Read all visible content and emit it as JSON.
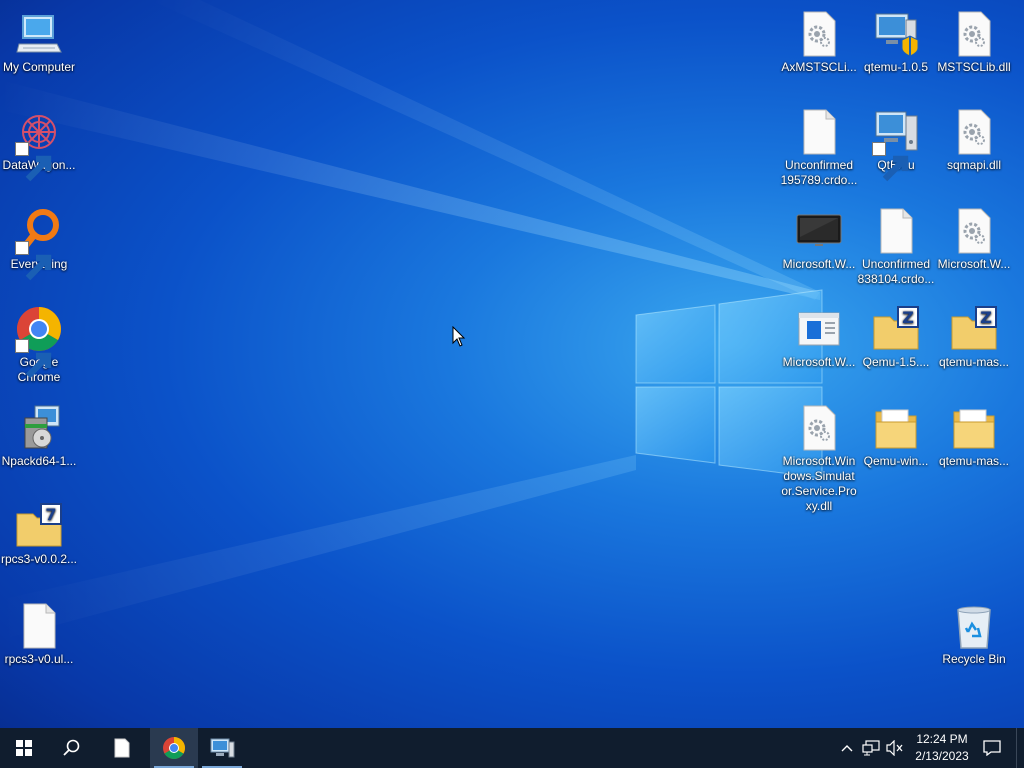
{
  "desktop": {
    "left_icons": [
      {
        "label": "My Computer",
        "icon": "computer-icon"
      },
      {
        "label": "DataWagon...",
        "icon": "datawagon-icon"
      },
      {
        "label": "Everything",
        "icon": "everything-icon"
      },
      {
        "label": "Google Chrome",
        "icon": "chrome-icon"
      },
      {
        "label": "Npackd64-1...",
        "icon": "installer-icon"
      },
      {
        "label": "rpcs3-v0.0.2...",
        "icon": "archive-7z-icon"
      },
      {
        "label": "rpcs3-v0.ul...",
        "icon": "blank-file-icon"
      }
    ],
    "right_icons": [
      {
        "label": "AxMSTSCLi...",
        "icon": "dll-file-icon"
      },
      {
        "label": "qtemu-1.0.5",
        "icon": "qtemu-setup-icon"
      },
      {
        "label": "MSTSCLib.dll",
        "icon": "dll-file-icon"
      },
      {
        "label": "Unconfirmed 195789.crdo...",
        "icon": "blank-file-icon"
      },
      {
        "label": "QtEmu",
        "icon": "qtemu-icon"
      },
      {
        "label": "sqmapi.dll",
        "icon": "dll-file-icon"
      },
      {
        "label": "Microsoft.W...",
        "icon": "monitor-icon"
      },
      {
        "label": "Unconfirmed 838104.crdo...",
        "icon": "blank-file-icon"
      },
      {
        "label": "Microsoft.W...",
        "icon": "dll-file-icon"
      },
      {
        "label": "Microsoft.W...",
        "icon": "window-app-icon"
      },
      {
        "label": "Qemu-1.5....",
        "icon": "archive-zip-folder-icon"
      },
      {
        "label": "qtemu-mas...",
        "icon": "archive-zip-folder-icon"
      },
      {
        "label": "Microsoft.Windows.Simulator.Service.Proxy.dll",
        "icon": "dll-file-icon"
      },
      {
        "label": "Qemu-win...",
        "icon": "folder-icon"
      },
      {
        "label": "qtemu-mas...",
        "icon": "folder-icon"
      },
      {
        "label": "Recycle Bin",
        "icon": "recycle-bin-icon"
      }
    ]
  },
  "taskbar": {
    "start": "start-icon",
    "search": "search-icon",
    "pinned": [
      "file-icon",
      "chrome-icon",
      "remote-desktop-icon"
    ],
    "tray": [
      "chevron-up-icon",
      "network-icon",
      "volume-muted-icon"
    ],
    "time": "12:24 PM",
    "date": "2/13/2023",
    "notifications": "action-center-icon"
  },
  "colors": {
    "taskbar_bg": "#101d2e",
    "wallpaper_accent": "#1a78de"
  }
}
